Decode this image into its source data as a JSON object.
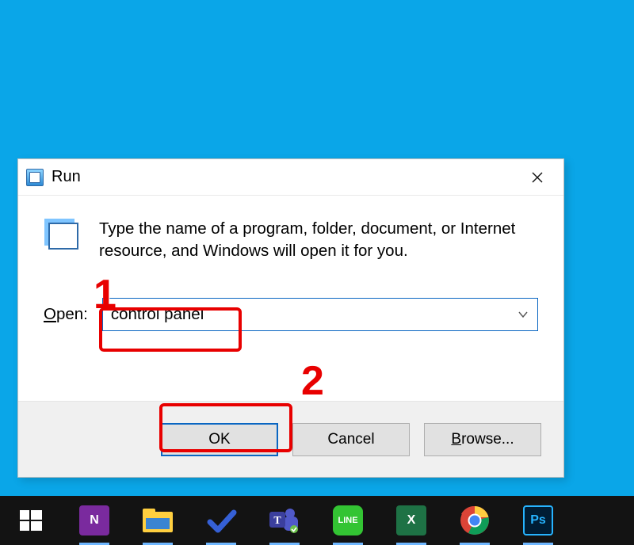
{
  "dialog": {
    "title": "Run",
    "description": "Type the name of a program, folder, document, or Internet resource, and Windows will open it for you.",
    "open_label_prefix": "O",
    "open_label_rest": "pen:",
    "input_value": "control panel",
    "buttons": {
      "ok": "OK",
      "cancel": "Cancel",
      "browse_prefix": "B",
      "browse_rest": "rowse..."
    }
  },
  "annotations": {
    "one": "1",
    "two": "2"
  },
  "taskbar": {
    "items": [
      {
        "name": "start-button"
      },
      {
        "name": "onenote-icon"
      },
      {
        "name": "file-explorer-icon"
      },
      {
        "name": "todo-icon"
      },
      {
        "name": "teams-icon"
      },
      {
        "name": "line-icon"
      },
      {
        "name": "excel-icon"
      },
      {
        "name": "chrome-icon"
      },
      {
        "name": "photoshop-icon"
      }
    ]
  }
}
